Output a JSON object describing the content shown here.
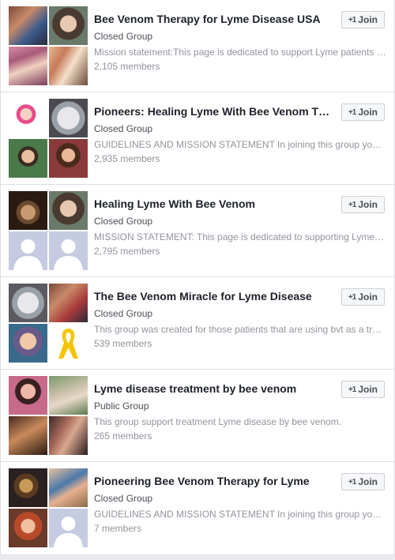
{
  "groups": [
    {
      "title": "Bee Venom Therapy for Lyme Disease USA",
      "privacy": "Closed Group",
      "description": "Mission statement:This page is dedicated to support Lyme patients who use bee venom therapy",
      "members": "2,105 members",
      "join_label": "Join",
      "thumbs": [
        "member-photo",
        "member-photo",
        "member-photo",
        "member-photo"
      ]
    },
    {
      "title": "Pioneers: Healing Lyme With Bee Venom Therapy",
      "privacy": "Closed Group",
      "description": "GUIDELINES AND MISSION STATEMENT In joining this group you agree to the following",
      "members": "2,935 members",
      "join_label": "Join",
      "thumbs": [
        "member-photo",
        "member-photo",
        "member-photo",
        "member-photo"
      ]
    },
    {
      "title": "Healing Lyme With Bee Venom",
      "privacy": "Closed Group",
      "description": "MISSION STATEMENT: This page is dedicated to supporting Lyme patients",
      "members": "2,795 members",
      "join_label": "Join",
      "thumbs": [
        "member-photo",
        "member-photo",
        "default-avatar",
        "default-avatar"
      ]
    },
    {
      "title": "The Bee Venom Miracle for Lyme Disease",
      "privacy": "Closed Group",
      "description": "This group was created for those patients that are using bvt as a treatment",
      "members": "539 members",
      "join_label": "Join",
      "thumbs": [
        "member-photo",
        "member-photo",
        "member-photo",
        "ribbon"
      ]
    },
    {
      "title": "Lyme disease treatment by bee venom",
      "privacy": "Public Group",
      "description": "This group support treatment Lyme disease by bee venom.",
      "members": "265 members",
      "join_label": "Join",
      "thumbs": [
        "member-photo",
        "member-photo",
        "member-photo",
        "member-photo"
      ]
    },
    {
      "title": "Pioneering Bee Venom Therapy for Lyme",
      "privacy": "Closed Group",
      "description": "GUIDELINES AND MISSION STATEMENT In joining this group you agree to the following",
      "members": "7 members",
      "join_label": "Join",
      "thumbs": [
        "member-photo",
        "member-photo",
        "member-photo",
        "default-avatar"
      ]
    }
  ],
  "colors": {
    "title": "#1d2129",
    "meta": "#90949c",
    "privacy": "#4b4f56",
    "button_bg": "#f6f7f9",
    "placeholder_bg": "#c5cbe1",
    "ribbon": "#f5c400"
  },
  "icons": {
    "join": "add-friend-plus-icon",
    "placeholder": "default-avatar-icon",
    "ribbon": "awareness-ribbon-icon"
  }
}
